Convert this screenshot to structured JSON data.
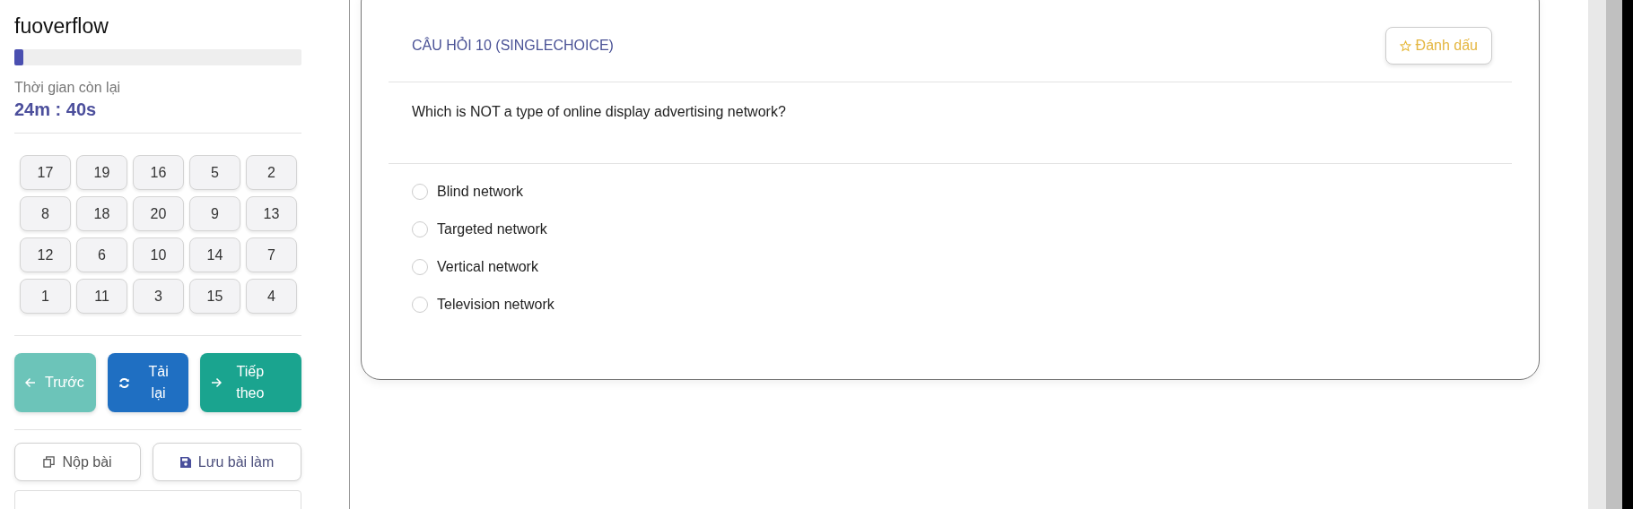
{
  "sidebar": {
    "title": "fuoverflow",
    "progress": {
      "level": 0.03
    },
    "timer_label": "Thời gian còn lại",
    "timer": "24m : 40s",
    "questions": [
      "17",
      "19",
      "16",
      "5",
      "2",
      "8",
      "18",
      "20",
      "9",
      "13",
      "12",
      "6",
      "10",
      "14",
      "7",
      "1",
      "11",
      "3",
      "15",
      "4"
    ],
    "nav_buttons": [
      {
        "kind": "prev",
        "label": "Trước"
      },
      {
        "kind": "reload",
        "label": "Tải lại"
      },
      {
        "kind": "next",
        "label": "Tiếp theo"
      }
    ],
    "action_buttons": [
      {
        "kind": "submit",
        "label": "Nộp bài"
      },
      {
        "kind": "save",
        "label": "Lưu bài làm"
      }
    ]
  },
  "question": {
    "header": "CÂU HỎI 10 (SINGLECHOICE)",
    "bookmark": "Đánh dấu",
    "text": "Which is NOT a type of online display advertising network?",
    "options": [
      {
        "label": "Blind network",
        "selected": false
      },
      {
        "label": "Targeted network",
        "selected": false
      },
      {
        "label": "Vertical network",
        "selected": false
      },
      {
        "label": "Television network",
        "selected": false
      }
    ]
  }
}
